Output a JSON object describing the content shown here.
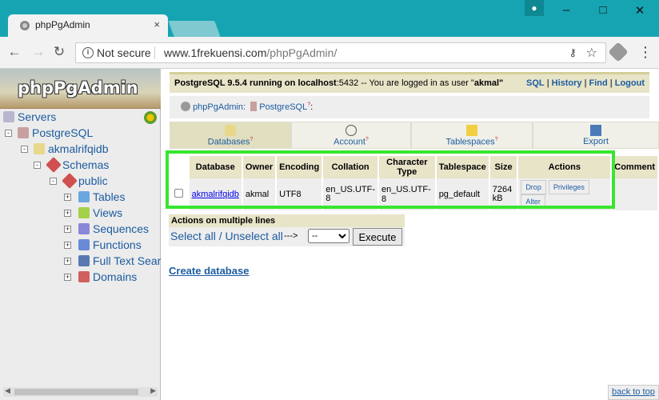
{
  "browser": {
    "tab_title": "phpPgAdmin",
    "tab_close": "×",
    "security_label": "Not secure",
    "url_host": "www.1frekuensi.com",
    "url_path": "/phpPgAdmin/"
  },
  "sidebar": {
    "logo": "phpPgAdmin",
    "tree": {
      "servers": "Servers",
      "postgresql": "PostgreSQL",
      "database": "akmalrifqidb",
      "schemas": "Schemas",
      "public": "public",
      "tables": "Tables",
      "views": "Views",
      "sequences": "Sequences",
      "functions": "Functions",
      "fulltext": "Full Text Searc",
      "domains": "Domains"
    }
  },
  "topbar": {
    "server_prefix": "PostgreSQL 9.5.4 running on ",
    "host": "localhost",
    "port_text": ":5432 -- You are logged in as user \"",
    "user": "akmal",
    "user_suffix": "\"",
    "links": [
      "SQL",
      "History",
      "Find",
      "Logout"
    ]
  },
  "trail": {
    "item1": "phpPgAdmin:",
    "item2": "PostgreSQL",
    "sup": "?",
    "tail": ":"
  },
  "tabs": [
    {
      "label": "Databases",
      "sup": "?"
    },
    {
      "label": "Account",
      "sup": "?"
    },
    {
      "label": "Tablespaces",
      "sup": "?"
    },
    {
      "label": "Export",
      "sup": ""
    }
  ],
  "table": {
    "headers": [
      "Database",
      "Owner",
      "Encoding",
      "Collation",
      "Character Type",
      "Tablespace",
      "Size",
      "Actions",
      "Comment"
    ],
    "row": {
      "database": "akmalrifqidb",
      "owner": "akmal",
      "encoding": "UTF8",
      "collation": "en_US.UTF-8",
      "ctype": "en_US.UTF-8",
      "tablespace": "pg_default",
      "size": "7264 kB",
      "actions": [
        "Drop",
        "Privileges",
        "Alter"
      ]
    }
  },
  "multi": {
    "header": "Actions on multiple lines",
    "select_all": "Select all",
    "divider": " / ",
    "unselect_all": "Unselect all",
    "arrow": "--->",
    "select_value": "--",
    "execute": "Execute"
  },
  "create_db": "Create database",
  "back_to_top": "back to top",
  "colors": {
    "titlebar": "#17a4b2",
    "highlight": "#39e52f",
    "link": "#1d5ca0",
    "header_bg": "#e8e4c8"
  }
}
